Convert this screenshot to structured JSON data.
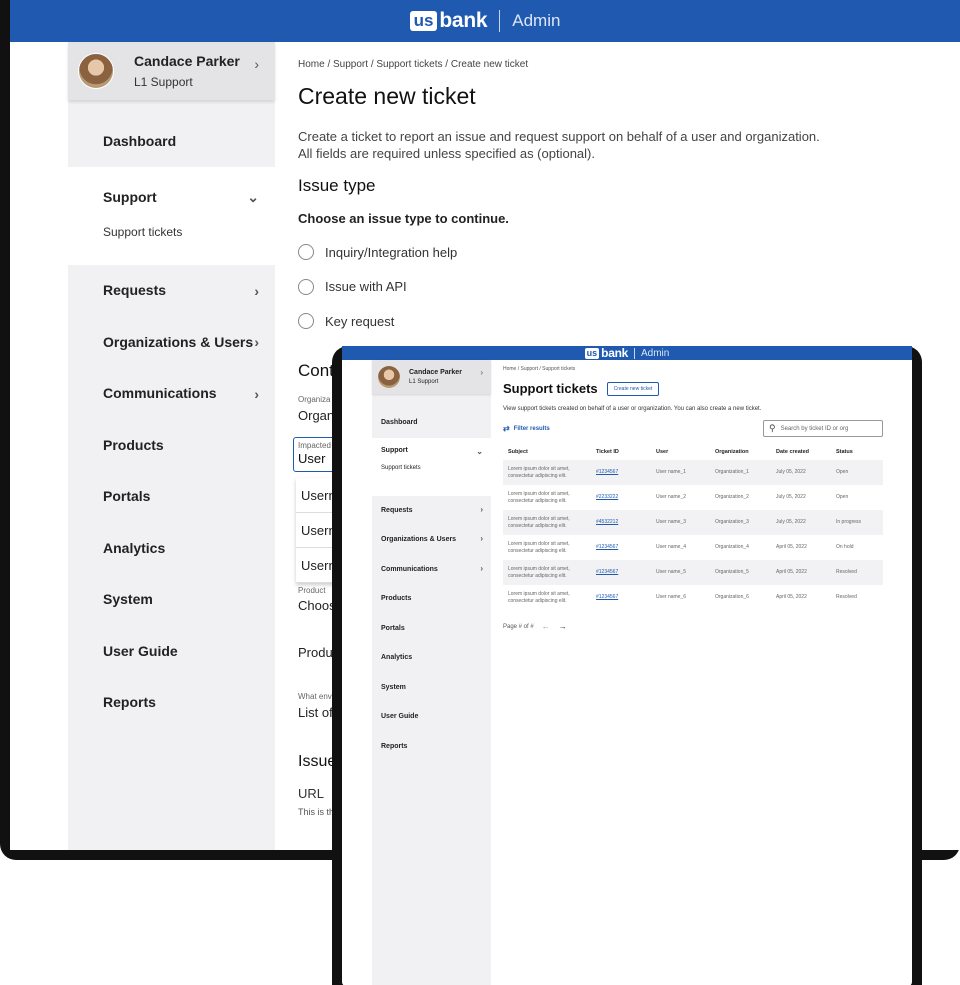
{
  "brand": {
    "us": "us",
    "bank": "bank",
    "app": "Admin"
  },
  "user": {
    "name": "Candace Parker",
    "role": "L1 Support"
  },
  "sidebar": {
    "items": [
      {
        "label": "Dashboard"
      },
      {
        "label": "Support",
        "sub": "Support tickets"
      },
      {
        "label": "Requests"
      },
      {
        "label": "Organizations & Users"
      },
      {
        "label": "Communications"
      },
      {
        "label": "Products"
      },
      {
        "label": "Portals"
      },
      {
        "label": "Analytics"
      },
      {
        "label": "System"
      },
      {
        "label": "User Guide"
      },
      {
        "label": "Reports"
      }
    ]
  },
  "create": {
    "breadcrumb": "Home  /  Support  /  Support tickets  /  Create new ticket",
    "title": "Create new ticket",
    "desc1": "Create a ticket to report an issue and request support on behalf of a user and organization.",
    "desc2": "All fields are required unless specified as (optional).",
    "issue_type": "Issue type",
    "choose": "Choose an issue type to continue.",
    "options": [
      "Inquiry/Integration help",
      "Issue with API",
      "Key request"
    ],
    "contact_partial": "Conta",
    "org_caption": "Organiza",
    "org_value": "Organi",
    "impacted_caption": "Impacted",
    "impacted_value": "User",
    "dropdown": [
      "Usern",
      "Usern",
      "Usern"
    ],
    "product_caption": "Product",
    "product_value": "Choos",
    "produc": "Produc",
    "env_caption": "What env",
    "env_value": "List of",
    "issue_partial": "Issue",
    "url": "URL",
    "url_help": "This is th"
  },
  "tickets": {
    "breadcrumb": "Home  /  Support  /  Support tickets",
    "title": "Support tickets",
    "create_btn": "Create new ticket",
    "desc": "View support tickets created on behalf of a user or organization. You can also create a new ticket.",
    "filter": "Filter results",
    "search_placeholder": "Search by ticket ID or org",
    "headers": [
      "Subject",
      "Ticket ID",
      "User",
      "Organization",
      "Date created",
      "Status"
    ],
    "rows": [
      {
        "subject1": "Lorem ipsum dolor sit amet,",
        "subject2": "consectetur adipiscing elit.",
        "id": "#1234567",
        "user": "User name_1",
        "org": "Organization_1",
        "date": "July 05, 2022",
        "status": "Open"
      },
      {
        "subject1": "Lorem ipsum dolor sit amet,",
        "subject2": "consectetur adipiscing elit.",
        "id": "#2233222",
        "user": "User name_2",
        "org": "Organization_2",
        "date": "July 05, 2022",
        "status": "Open"
      },
      {
        "subject1": "Lorem ipsum dolor sit amet,",
        "subject2": "consectetur adipiscing elit.",
        "id": "#4532212",
        "user": "User name_3",
        "org": "Organization_3",
        "date": "July 05, 2022",
        "status": "In progress"
      },
      {
        "subject1": "Lorem ipsum dolor sit amet,",
        "subject2": "consectetur adipiscing elit.",
        "id": "#1234567",
        "user": "User name_4",
        "org": "Organization_4",
        "date": "April 05, 2022",
        "status": "On hold"
      },
      {
        "subject1": "Lorem ipsum dolor sit amet,",
        "subject2": "consectetur adipiscing elit.",
        "id": "#1234567",
        "user": "User name_5",
        "org": "Organization_5",
        "date": "April 05, 2022",
        "status": "Resolved"
      },
      {
        "subject1": "Lorem ipsum dolor sit amet,",
        "subject2": "consectetur adipiscing elit.",
        "id": "#1234567",
        "user": "User name_6",
        "org": "Organization_6",
        "date": "April 05, 2022",
        "status": "Resolved"
      }
    ],
    "pagination": "Page # of #"
  },
  "icons": {
    "chevron_right": "›",
    "chevron_down": "⌄",
    "arrow_left": "←",
    "arrow_right": "→",
    "search": "⚲",
    "filter": "⇄"
  },
  "colors": {
    "brand_blue": "#1f5ab0"
  }
}
